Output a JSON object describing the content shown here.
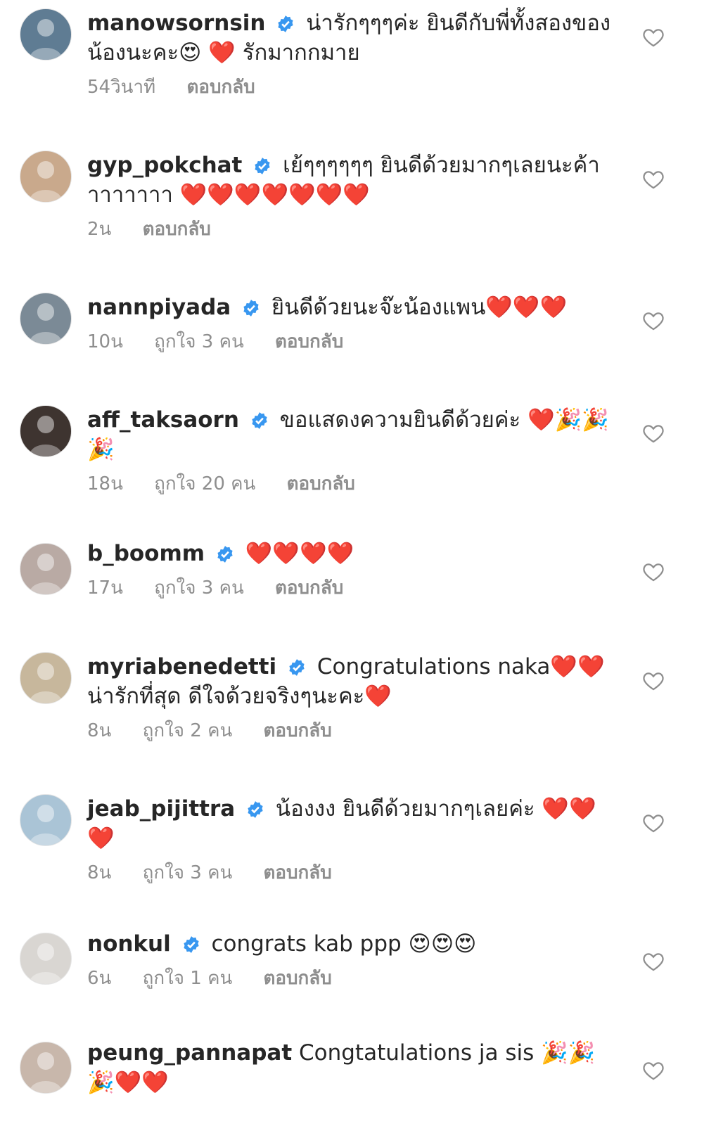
{
  "comments": [
    {
      "username": "manowsornsin",
      "verified": true,
      "text": "น่ารักๆๆๆค่ะ ยินดีกับพี่ทั้งสองของน้องนะคะ😍 ❤️ รักมากกมาย",
      "time": "54วินาที",
      "likes": "",
      "reply": "ตอบกลับ",
      "avatar_color": "#5f7c93"
    },
    {
      "username": "gyp_pokchat",
      "verified": true,
      "text": "เย้ๆๆๆๆๆๆ ยินดีด้วยมากๆเลยนะค้าาาาาาาา ❤️❤️❤️❤️❤️❤️❤️",
      "time": "2น",
      "likes": "",
      "reply": "ตอบกลับ",
      "avatar_color": "#c9a98c"
    },
    {
      "username": "nannpiyada",
      "verified": true,
      "text": "ยินดีด้วยนะจ๊ะน้องแพน❤️❤️❤️",
      "time": "10น",
      "likes": "ถูกใจ 3 คน",
      "reply": "ตอบกลับ",
      "avatar_color": "#7b8a96"
    },
    {
      "username": "aff_taksaorn",
      "verified": true,
      "text": "ขอแสดงความยินดีด้วยค่ะ ❤️🎉🎉🎉",
      "time": "18น",
      "likes": "ถูกใจ 20 คน",
      "reply": "ตอบกลับ",
      "avatar_color": "#3e3430"
    },
    {
      "username": "b_boomm",
      "verified": true,
      "text": "❤️❤️❤️❤️",
      "time": "17น",
      "likes": "ถูกใจ 3 คน",
      "reply": "ตอบกลับ",
      "avatar_color": "#b9aaa4"
    },
    {
      "username": "myriabenedetti",
      "verified": true,
      "text": "Congratulations naka❤️❤️ น่ารักที่สุด ดีใจด้วยจริงๆนะคะ❤️",
      "time": "8น",
      "likes": "ถูกใจ 2 คน",
      "reply": "ตอบกลับ",
      "avatar_color": "#c7b79c"
    },
    {
      "username": "jeab_pijittra",
      "verified": true,
      "text": "น้องงง ยินดีด้วยมากๆเลยค่ะ ❤️❤️❤️",
      "time": "8น",
      "likes": "ถูกใจ 3 คน",
      "reply": "ตอบกลับ",
      "avatar_color": "#aac4d6"
    },
    {
      "username": "nonkul",
      "verified": true,
      "text": "congrats kab ppp 😍😍😍",
      "time": "6น",
      "likes": "ถูกใจ 1 คน",
      "reply": "ตอบกลับ",
      "avatar_color": "#d9d6d2"
    },
    {
      "username": "peung_pannapat",
      "verified": false,
      "text": "Congtatulations ja sis 🎉🎉🎉❤️❤️",
      "time": "",
      "likes": "",
      "reply": "",
      "avatar_color": "#c8b7ab"
    }
  ]
}
